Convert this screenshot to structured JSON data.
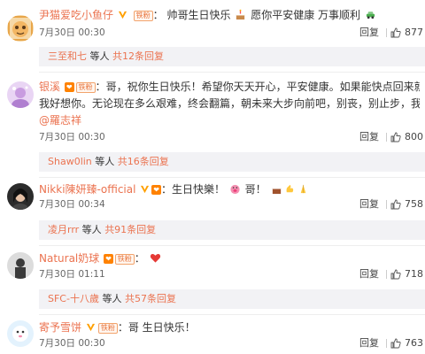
{
  "comments": [
    {
      "username": "尹猫爱吃小鱼仔",
      "text": "帅哥生日快乐",
      "text2": " 愿你平安健康 万事顺利",
      "fan_label": "铁粉",
      "date": "7月30日 00:30",
      "reply_label": "回复",
      "likes": "877",
      "sub": {
        "user": "三至和七",
        "mid": " 等人 ",
        "more": "共12条回复"
      }
    },
    {
      "username": "银溪",
      "text_line1": "哥，祝你生日快乐！希望你天天开心，平安健康。如果能快点回来就快点吧……",
      "text_line2": "我好想你。无论现在多么艰难，终会翻篇，朝未来大步向前吧，别丧，别止步，我陪你走到底。",
      "mention": "@羅志祥",
      "fan_label": "铁粉",
      "date": "7月30日 00:30",
      "reply_label": "回复",
      "likes": "800",
      "sub": {
        "user": "Shaw0lin",
        "mid": " 等人 ",
        "more": "共16条回复"
      }
    },
    {
      "username": "Nikki陳妍臻-official",
      "text": "生日快樂！",
      "text2": "哥！",
      "date": "7月30日 00:34",
      "reply_label": "回复",
      "likes": "758",
      "sub": {
        "user": "凌月rrr",
        "mid": " 等人 ",
        "more": "共91条回复"
      }
    },
    {
      "username": "Natural奶球",
      "fan_label": "铁粉",
      "date": "7月30日 01:11",
      "reply_label": "回复",
      "likes": "718",
      "sub": {
        "user": "SFC-十八歲",
        "mid": " 等人 ",
        "more": "共57条回复"
      }
    },
    {
      "username": "寄予雪饼",
      "text": "哥 生日快乐！",
      "fan_label": "铁粉",
      "date": "7月30日 00:30",
      "reply_label": "回复",
      "likes": "763"
    }
  ],
  "colon": "：",
  "accent": "#eb7350",
  "icons": [
    "verified-v-icon",
    "fan-level-icon",
    "thumb-up-icon",
    "cake-emoji",
    "heart-emoji"
  ]
}
